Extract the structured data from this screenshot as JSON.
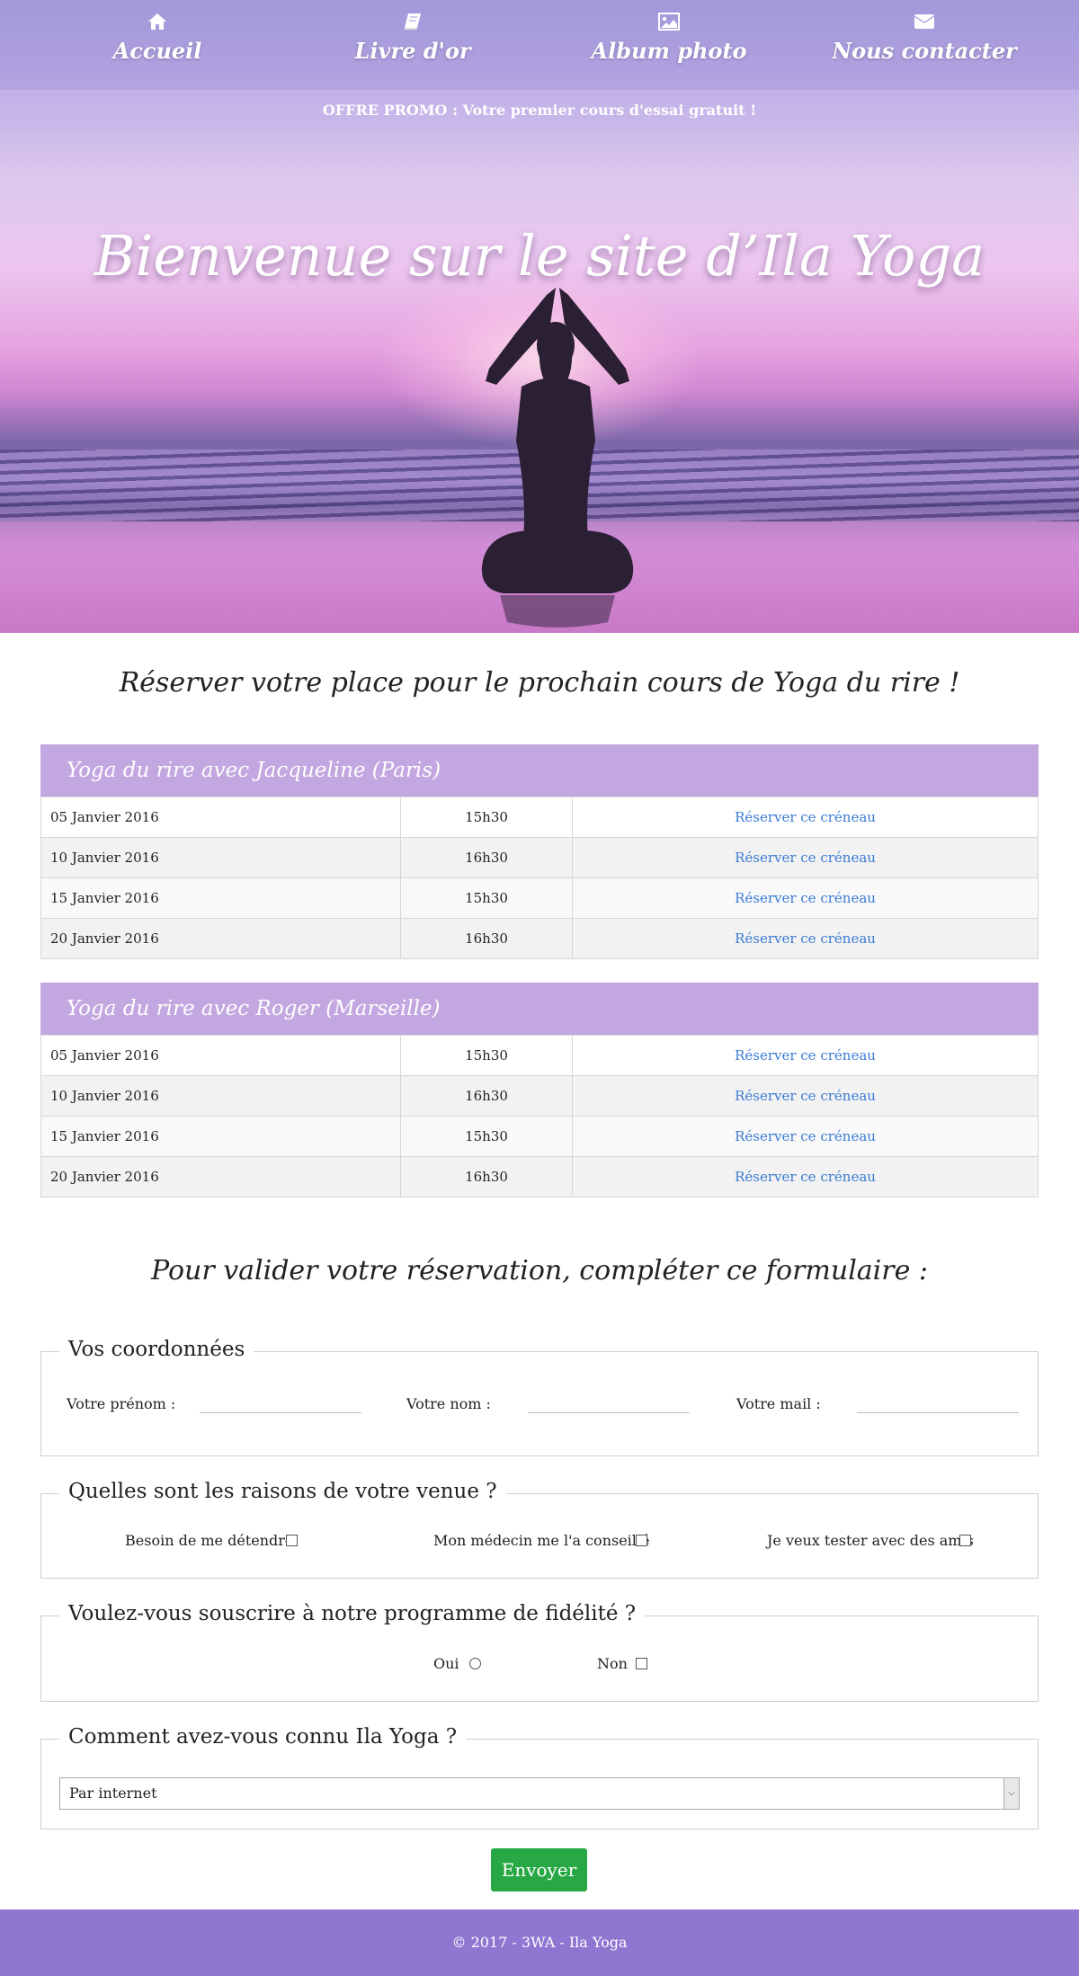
{
  "nav": {
    "items": [
      {
        "label": "Accueil",
        "icon": "home-icon"
      },
      {
        "label": "Livre d'or",
        "icon": "book-icon"
      },
      {
        "label": "Album photo",
        "icon": "image-icon"
      },
      {
        "label": "Nous contacter",
        "icon": "envelope-icon"
      }
    ]
  },
  "promo": "OFFRE PROMO : Votre premier cours d'essai gratuit !",
  "hero": {
    "title": "Bienvenue sur le site d’Ila Yoga"
  },
  "booking": {
    "title": "Réserver votre place pour le prochain cours de Yoga du rire !",
    "panels": [
      {
        "title": "Yoga du rire avec Jacqueline (Paris)",
        "rows": [
          {
            "date": "05 Janvier 2016",
            "time": "15h30",
            "action": "Réserver ce créneau"
          },
          {
            "date": "10 Janvier 2016",
            "time": "16h30",
            "action": "Réserver ce créneau"
          },
          {
            "date": "15 Janvier 2016",
            "time": "15h30",
            "action": "Réserver ce créneau"
          },
          {
            "date": "20 Janvier 2016",
            "time": "16h30",
            "action": "Réserver ce créneau"
          }
        ]
      },
      {
        "title": "Yoga du rire avec Roger (Marseille)",
        "rows": [
          {
            "date": "05 Janvier 2016",
            "time": "15h30",
            "action": "Réserver ce créneau"
          },
          {
            "date": "10 Janvier 2016",
            "time": "16h30",
            "action": "Réserver ce créneau"
          },
          {
            "date": "15 Janvier 2016",
            "time": "15h30",
            "action": "Réserver ce créneau"
          },
          {
            "date": "20 Janvier 2016",
            "time": "16h30",
            "action": "Réserver ce créneau"
          }
        ]
      }
    ]
  },
  "form": {
    "title": "Pour valider votre réservation, compléter ce formulaire :",
    "coords": {
      "legend": "Vos coordonnées",
      "firstname_label": "Votre prénom :",
      "lastname_label": "Votre nom :",
      "email_label": "Votre mail :"
    },
    "reasons": {
      "legend": "Quelles sont les raisons de votre venue ?",
      "options": [
        "Besoin de me détendre",
        "Mon médecin me l'a conseillé",
        "Je veux tester avec des amis"
      ]
    },
    "loyalty": {
      "legend": "Voulez-vous souscrire à notre programme de fidélité ?",
      "yes": "Oui",
      "no": "Non"
    },
    "source": {
      "legend": "Comment avez-vous connu Ila Yoga ?",
      "selected": "Par internet"
    },
    "submit": "Envoyer"
  },
  "footer": "© 2017 - 3WA - Ila Yoga",
  "colors": {
    "nav_bg": "#a59ad9",
    "panel_head": "#c3a7e0",
    "link": "#3a7bd5",
    "submit": "#28a745",
    "footer": "#8f77d1"
  }
}
